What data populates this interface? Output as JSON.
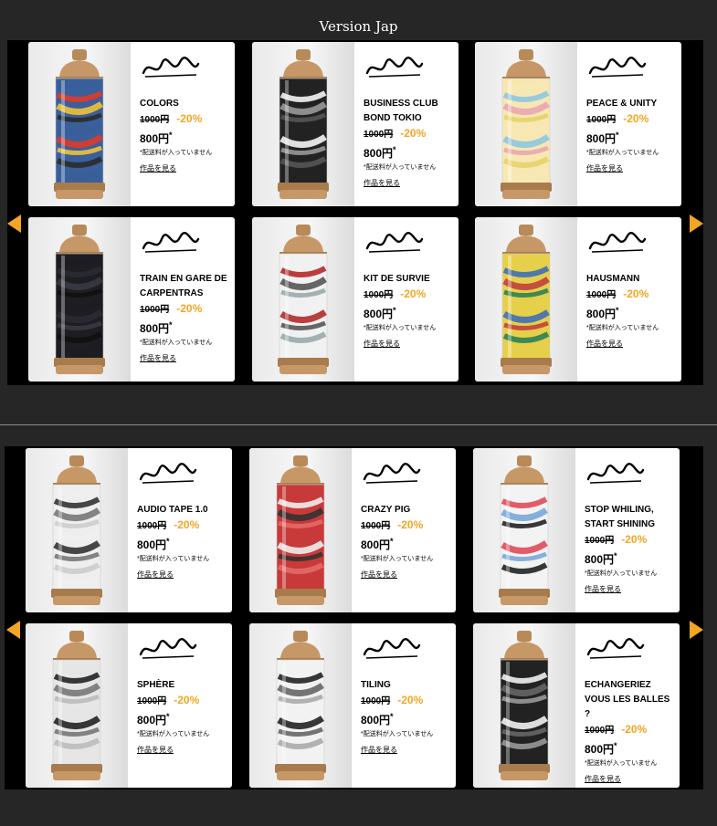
{
  "page_title": "Version Jap",
  "common": {
    "old_price": "1000円",
    "discount": "-20%",
    "new_price": "800円",
    "asterisk": "*",
    "note": "*配送料が入っていません",
    "link": "作品を見る"
  },
  "colors": {
    "accent": "#f3a623",
    "background": "#262626",
    "band": "#000000"
  },
  "carousel1": {
    "products": [
      {
        "name_lines": [
          "COLORS"
        ],
        "tag": "SEAT"
      },
      {
        "name_lines": [
          "BUSINESS CLUB",
          "BOND TOKIO"
        ],
        "tag": "BOND"
      },
      {
        "name_lines": [
          "PEACE & UNITY"
        ],
        "tag": "SYK"
      },
      {
        "name_lines": [
          "TRAIN EN GARE DE",
          "CARPENTRAS"
        ],
        "tag": "ARC"
      },
      {
        "name_lines": [
          "KIT DE SURVIE"
        ],
        "tag": "Taroe"
      },
      {
        "name_lines": [
          "HAUSMANN"
        ],
        "tag": "NKERN"
      }
    ]
  },
  "carousel2": {
    "products": [
      {
        "name_lines": [
          "AUDIO TAPE 1.0"
        ],
        "tag": "Skarz"
      },
      {
        "name_lines": [
          "CRAZY PIG"
        ],
        "tag": "Stomer"
      },
      {
        "name_lines": [
          "STOP WHILING,",
          "START SHINING"
        ],
        "tag": "ROK"
      },
      {
        "name_lines": [
          "SPHÈRE"
        ],
        "tag": "Sph"
      },
      {
        "name_lines": [
          "TILING"
        ],
        "tag": "Dero"
      },
      {
        "name_lines": [
          "ECHANGERIEZ",
          "VOUS LES BALLES ?"
        ],
        "tag": "Kuji"
      }
    ]
  }
}
